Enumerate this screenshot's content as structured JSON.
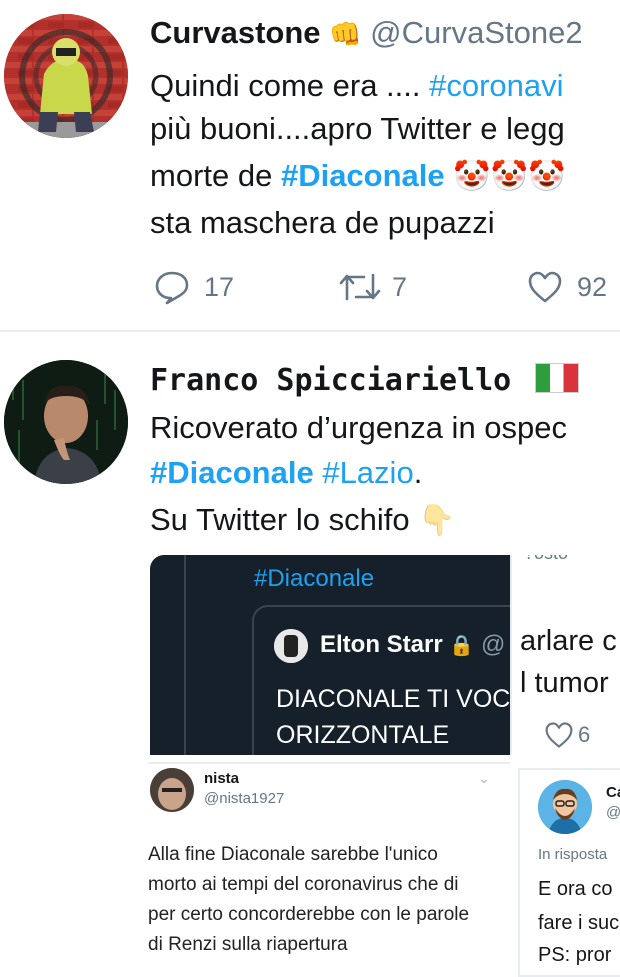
{
  "tweet1": {
    "display_name": "Curvastone",
    "handle": "@CurvaStone2",
    "lines": [
      {
        "pre": "Quindi come era .... ",
        "tag": "#coronavi"
      },
      {
        "text": "più buoni....apro Twitter e legg"
      },
      {
        "pre": "morte de ",
        "tag": "#Diaconale",
        "emoji": "🤡🤡🤡"
      },
      {
        "text": "sta maschera de pupazzi"
      }
    ],
    "replies": "17",
    "retweets": "7",
    "likes": "92"
  },
  "tweet2": {
    "display_name": "Franco Spicciariello",
    "lines": [
      {
        "text": "Ricoverato d’urgenza in ospec"
      },
      {
        "tag1": "#Diaconale",
        "tag2": "#Lazio",
        "post": "."
      },
      {
        "text": "Su Twitter lo schifo"
      }
    ],
    "emoji_point": "👇"
  },
  "screenshot1": {
    "hashtag": "#Diaconale",
    "quoted_name": "Elton Starr",
    "quoted_handle": "@",
    "quoted_text_line1": "DIACONALE TI VOC",
    "quoted_text_line2": "ORIZZONTALE",
    "right_text_top": "?osto",
    "right_text_line1": "arlare c",
    "right_text_line2": "l tumor",
    "right_like_count": "6"
  },
  "screenshot2": {
    "name": "nista",
    "handle": "@nista1927",
    "text_lines": [
      "Alla fine Diaconale sarebbe l'unico",
      "morto ai tempi del coronavirus che di",
      "per certo concorderebbe con le parole",
      "di Renzi sulla riapertura"
    ]
  },
  "screenshot3": {
    "name": "Ca",
    "handle": "@",
    "reply_label": "In risposta",
    "text_lines": [
      "E ora co",
      "fare i suc",
      "PS: pror"
    ]
  },
  "colors": {
    "link": "#1da1f2",
    "text": "#14171a",
    "muted": "#657786",
    "dark_card": "#15202b"
  }
}
